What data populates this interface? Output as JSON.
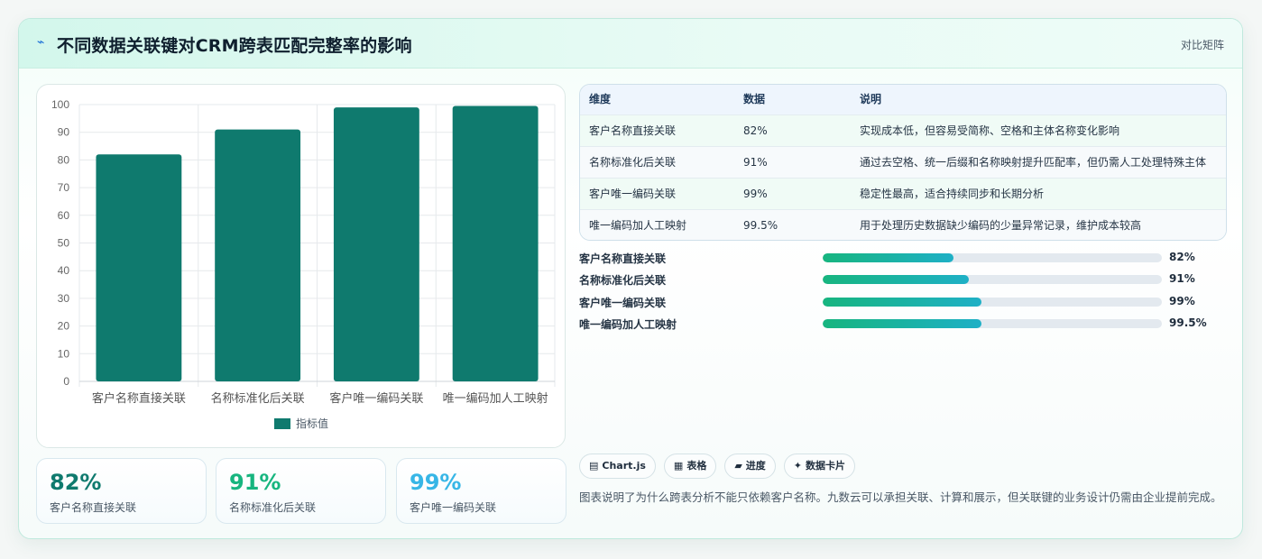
{
  "header": {
    "title": "不同数据关联键对CRM跨表匹配完整率的影响",
    "right_label": "对比矩阵",
    "title_icon": "lightning-icon"
  },
  "chart_data": {
    "type": "bar",
    "categories": [
      "客户名称直接关联",
      "名称标准化后关联",
      "客户唯一编码关联",
      "唯一编码加人工映射"
    ],
    "series": [
      {
        "name": "指标值",
        "values": [
          82,
          91,
          99,
          99.5
        ]
      }
    ],
    "ylim": [
      0,
      100
    ],
    "yticks": [
      0,
      10,
      20,
      30,
      40,
      50,
      60,
      70,
      80,
      90,
      100
    ],
    "grid": true,
    "legend": "bottom",
    "color": "#0f7a6e"
  },
  "stats": [
    {
      "value": "82%",
      "label": "客户名称直接关联",
      "color": "#0f7a6e"
    },
    {
      "value": "91%",
      "label": "名称标准化后关联",
      "color": "#17b57f"
    },
    {
      "value": "99%",
      "label": "客户唯一编码关联",
      "color": "#37b6e6"
    }
  ],
  "table": {
    "headers": [
      "维度",
      "数据",
      "说明"
    ],
    "rows": [
      [
        "客户名称直接关联",
        "82%",
        "实现成本低，但容易受简称、空格和主体名称变化影响"
      ],
      [
        "名称标准化后关联",
        "91%",
        "通过去空格、统一后缀和名称映射提升匹配率，但仍需人工处理特殊主体"
      ],
      [
        "客户唯一编码关联",
        "99%",
        "稳定性最高，适合持续同步和长期分析"
      ],
      [
        "唯一编码加人工映射",
        "99.5%",
        "用于处理历史数据缺少编码的少量异常记录，维护成本较高"
      ]
    ]
  },
  "progress": [
    {
      "label": "客户名称直接关联",
      "value": "82%",
      "fraction": 0.385
    },
    {
      "label": "名称标准化后关联",
      "value": "91%",
      "fraction": 0.43
    },
    {
      "label": "客户唯一编码关联",
      "value": "99%",
      "fraction": 0.467
    },
    {
      "label": "唯一编码加人工映射",
      "value": "99.5%",
      "fraction": 0.467
    }
  ],
  "tags": [
    {
      "icon": "chart-icon",
      "glyph": "▤",
      "label": "Chart.js"
    },
    {
      "icon": "table-icon",
      "glyph": "▦",
      "label": "表格"
    },
    {
      "icon": "progress-icon",
      "glyph": "▰",
      "label": "进度"
    },
    {
      "icon": "sparkle-icon",
      "glyph": "✦",
      "label": "数据卡片"
    }
  ],
  "description": "图表说明了为什么跨表分析不能只依赖客户名称。九数云可以承担关联、计算和展示，但关联键的业务设计仍需由企业提前完成。"
}
